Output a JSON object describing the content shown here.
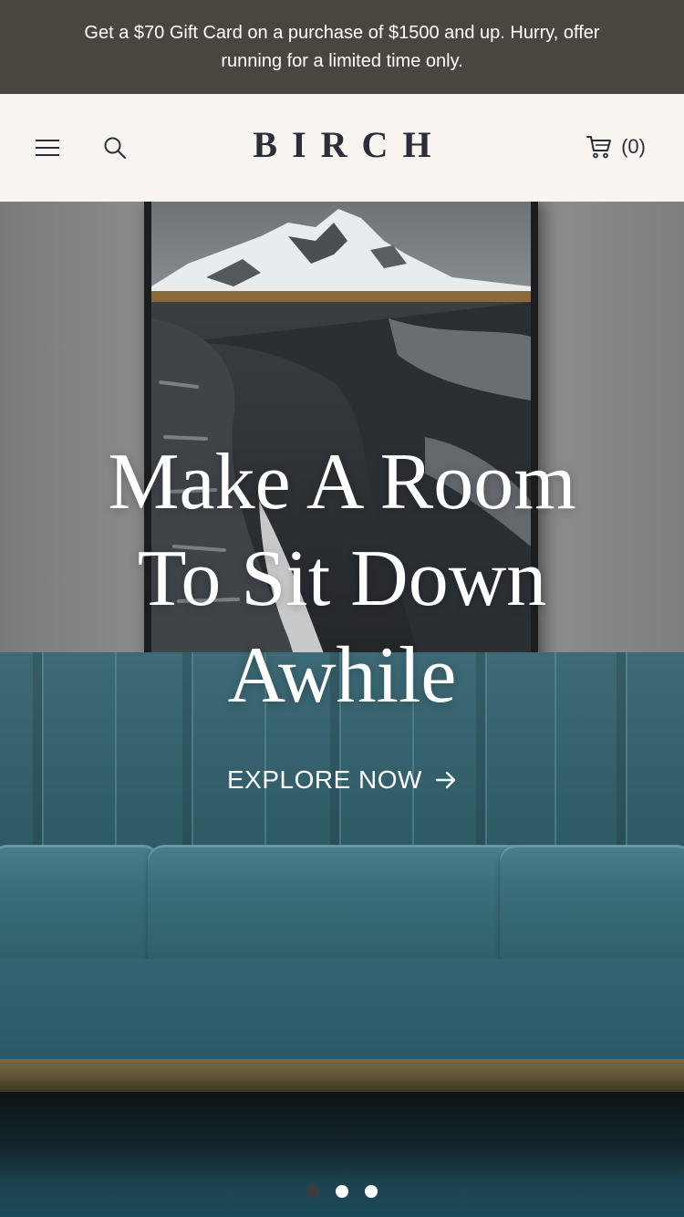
{
  "promo": {
    "text": "Get a $70 Gift Card on a purchase of $1500 and up. Hurry, offer running for a limited time only."
  },
  "header": {
    "logo": "BIRCH",
    "menu_icon": "hamburger-menu-icon",
    "search_icon": "search-icon",
    "cart_icon": "shopping-cart-icon",
    "cart_count": "(0)"
  },
  "hero": {
    "title_lines": [
      "Make A Room",
      "To Sit Down",
      "Awhile"
    ],
    "cta_label": "EXPLORE NOW",
    "cta_icon": "arrow-right-icon",
    "slides": [
      {
        "active": true
      },
      {
        "active": false
      },
      {
        "active": false
      }
    ]
  },
  "colors": {
    "promo_bg": "#4a453f",
    "header_bg": "#f8f5f0",
    "logo": "#2b2d3a",
    "sofa": "#2f5b67"
  }
}
